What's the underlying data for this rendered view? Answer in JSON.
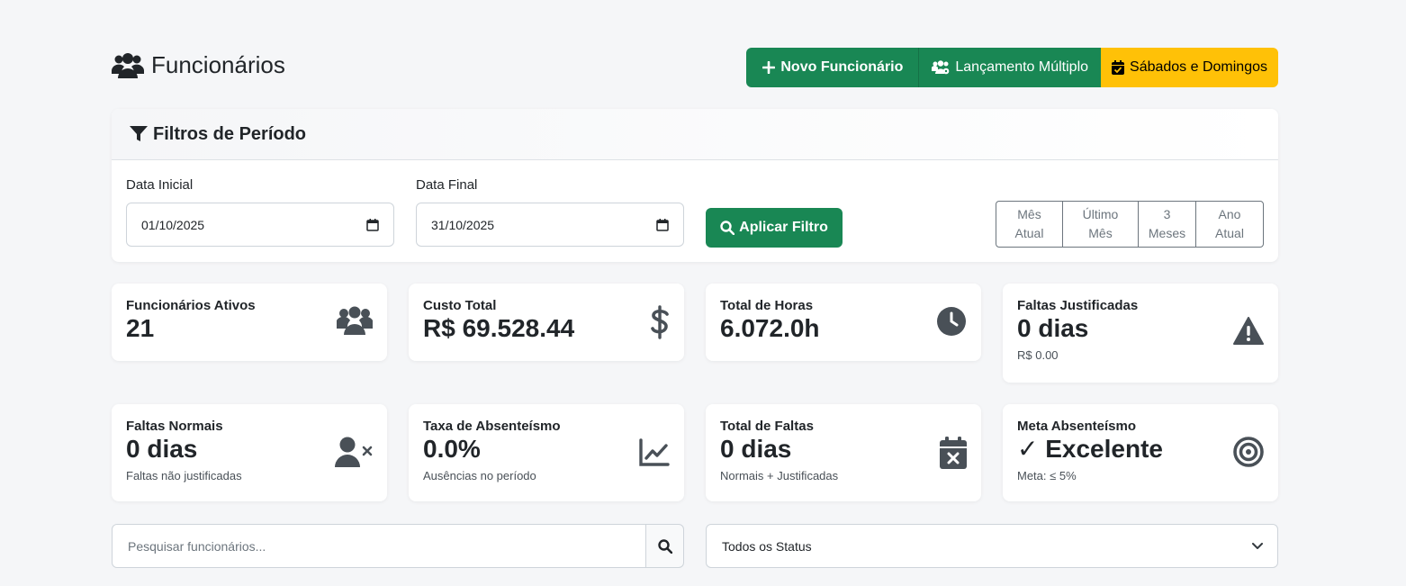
{
  "header": {
    "title": "Funcionários",
    "buttons": {
      "novo": "Novo Funcionário",
      "multiplo": "Lançamento Múltiplo",
      "sabados": "Sábados e Domingos"
    }
  },
  "filters": {
    "title": "Filtros de Período",
    "start_label": "Data Inicial",
    "start_value": "01/10/2025",
    "end_label": "Data Final",
    "end_value": "31/10/2025",
    "apply_label": "Aplicar Filtro",
    "periods": [
      {
        "line1": "Mês",
        "line2": "Atual"
      },
      {
        "line1": "Último",
        "line2": "Mês"
      },
      {
        "line1": "3",
        "line2": "Meses"
      },
      {
        "line1": "Ano",
        "line2": "Atual"
      }
    ]
  },
  "stats": {
    "ativos": {
      "title": "Funcionários Ativos",
      "value": "21"
    },
    "custo": {
      "title": "Custo Total",
      "value": "R$ 69.528.44"
    },
    "horas": {
      "title": "Total de Horas",
      "value": "6.072.0h"
    },
    "justificadas": {
      "title": "Faltas Justificadas",
      "value": "0 dias",
      "sub": "R$ 0.00"
    },
    "normais": {
      "title": "Faltas Normais",
      "value": "0 dias",
      "sub": "Faltas não justificadas"
    },
    "taxa": {
      "title": "Taxa de Absenteísmo",
      "value": "0.0%",
      "sub": "Ausências no período"
    },
    "total_faltas": {
      "title": "Total de Faltas",
      "value": "0 dias",
      "sub": "Normais + Justificadas"
    },
    "meta": {
      "title": "Meta Absenteísmo",
      "value": "✓ Excelente",
      "sub": "Meta: ≤ 5%"
    }
  },
  "search": {
    "placeholder": "Pesquisar funcionários...",
    "status_value": "Todos os Status"
  },
  "colors": {
    "primary_green": "#198754",
    "warning_yellow": "#ffc107",
    "icon_gray": "#495057"
  },
  "icons": {
    "title": "users-icon",
    "novo": "plus-icon",
    "multiplo": "users-cog-icon",
    "sabados": "calendar-check-icon",
    "filter": "filter-icon",
    "search": "search-icon"
  }
}
